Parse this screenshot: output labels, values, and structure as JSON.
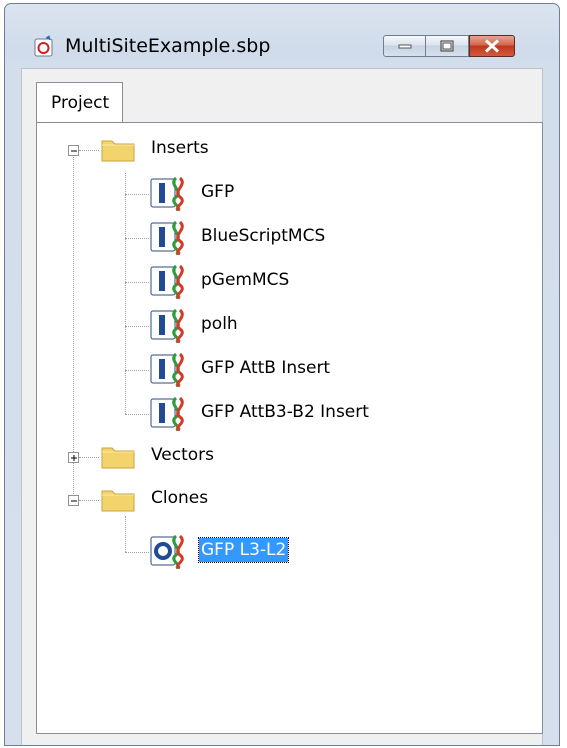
{
  "window": {
    "title": "MultiSiteExample.sbp"
  },
  "tabs": [
    {
      "label": "Project"
    }
  ],
  "tree": {
    "inserts": {
      "label": "Inserts",
      "items": [
        {
          "label": "GFP"
        },
        {
          "label": "BlueScriptMCS"
        },
        {
          "label": "pGemMCS"
        },
        {
          "label": "polh"
        },
        {
          "label": "GFP AttB Insert"
        },
        {
          "label": "GFP AttB3-B2 Insert"
        }
      ]
    },
    "vectors": {
      "label": "Vectors"
    },
    "clones": {
      "label": "Clones",
      "items": [
        {
          "label": "GFP L3-L2",
          "selected": true
        }
      ]
    }
  },
  "colors": {
    "selection": "#3399ff",
    "folder": "#f3d36b",
    "close_button": "#c7452a"
  }
}
